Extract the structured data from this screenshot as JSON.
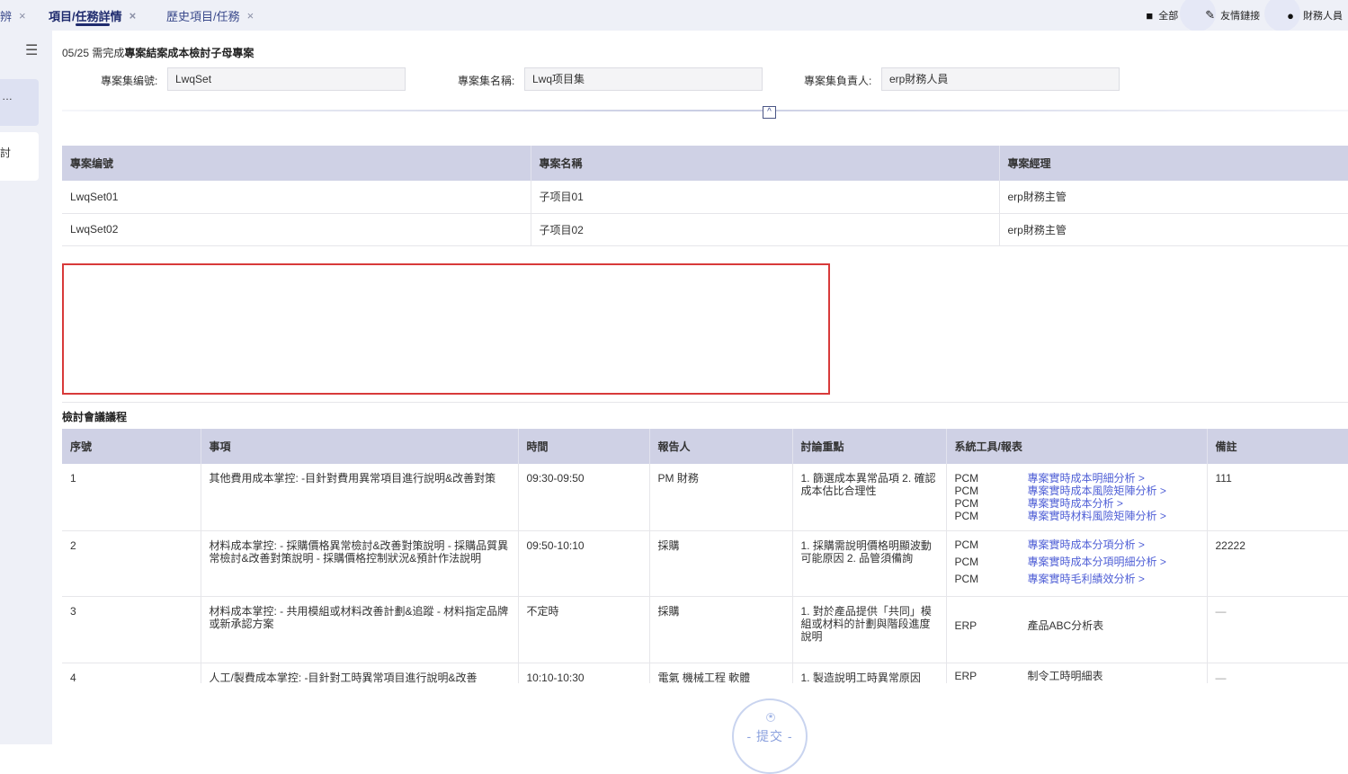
{
  "tabs": [
    {
      "label": "辨",
      "close": "×"
    },
    {
      "label": "項目/任務詳情",
      "close": "×"
    },
    {
      "label": "歷史項目/任務",
      "close": "×"
    }
  ],
  "topright": {
    "all": "全部",
    "links": "友情鏈接",
    "user": "財務人員"
  },
  "sidebar": {
    "item1": "…",
    "item2": "討"
  },
  "page": {
    "title_prefix": "05/25 需完成",
    "title_bold": "專案結案成本檢討子母專案"
  },
  "form": {
    "set_no_label": "專案集编號:",
    "set_no_value": "LwqSet",
    "set_name_label": "專案集名稱:",
    "set_name_value": "Lwq项目集",
    "owner_label": "專案集負責人:",
    "owner_value": "erp財務人員"
  },
  "project_table": {
    "headers": [
      "專案编號",
      "專案名稱",
      "專案經理"
    ],
    "rows": [
      [
        "LwqSet01",
        "子项目01",
        "erp財務主管"
      ],
      [
        "LwqSet02",
        "子项目02",
        "erp財務主管"
      ]
    ]
  },
  "agenda": {
    "title": "檢討會議議程",
    "headers": [
      "序號",
      "事項",
      "時間",
      "報告人",
      "討論重點",
      "系統工具/報表",
      "備註"
    ],
    "rows": [
      {
        "no": "1",
        "item": "其他費用成本掌控: -目針對費用異常項目進行說明&改善對策",
        "time": "09:30-09:50",
        "reporter": "PM 財務",
        "focus": "1. 篩選成本異常品項 2. 確認成本估比合理性",
        "sources": [
          "PCM",
          "PCM",
          "PCM",
          "PCM"
        ],
        "links": [
          "專案實時成本明細分析 >",
          "專案實時成本風險矩陣分析 >",
          "專案實時成本分析 >",
          "專案實時材料風險矩陣分析 >"
        ],
        "note": "111"
      },
      {
        "no": "2",
        "item": "材料成本掌控: - 採購價格異常檢討&改善對策說明 - 採購品質異常檢討&改善對策說明 - 採購價格控制狀況&預計作法說明",
        "time": "09:50-10:10",
        "reporter": "採購",
        "focus": "1. 採購需說明價格明顯波動可能原因 2. 品管須備詢",
        "sources": [
          "PCM",
          "PCM",
          "PCM"
        ],
        "links": [
          "專案實時成本分項分析 >",
          "專案實時成本分項明細分析 >",
          "專案實時毛利績效分析 >"
        ],
        "note": "22222"
      },
      {
        "no": "3",
        "item": "材料成本掌控: - 共用模組或材料改善計劃&追蹤 - 材料指定品牌或新承認方案",
        "time": "不定時",
        "reporter": "採購",
        "focus": "1. 對於產品提供「共同」模組或材料的計劃與階段進度說明",
        "sources": [
          "ERP"
        ],
        "plain": "產品ABC分析表",
        "note": "—"
      },
      {
        "no": "4",
        "item": "人工/製費成本掌控: -目針對工時異常項目進行說明&改善",
        "time": "10:10-10:30",
        "reporter": "電氣 機械工程 軟體",
        "focus": "1. 製造說明工時異常原因",
        "sources": [
          "ERP"
        ],
        "plain": "制令工時明細表",
        "note": "—"
      }
    ]
  },
  "submit": {
    "label": "- 提交 -",
    "star": "★"
  }
}
